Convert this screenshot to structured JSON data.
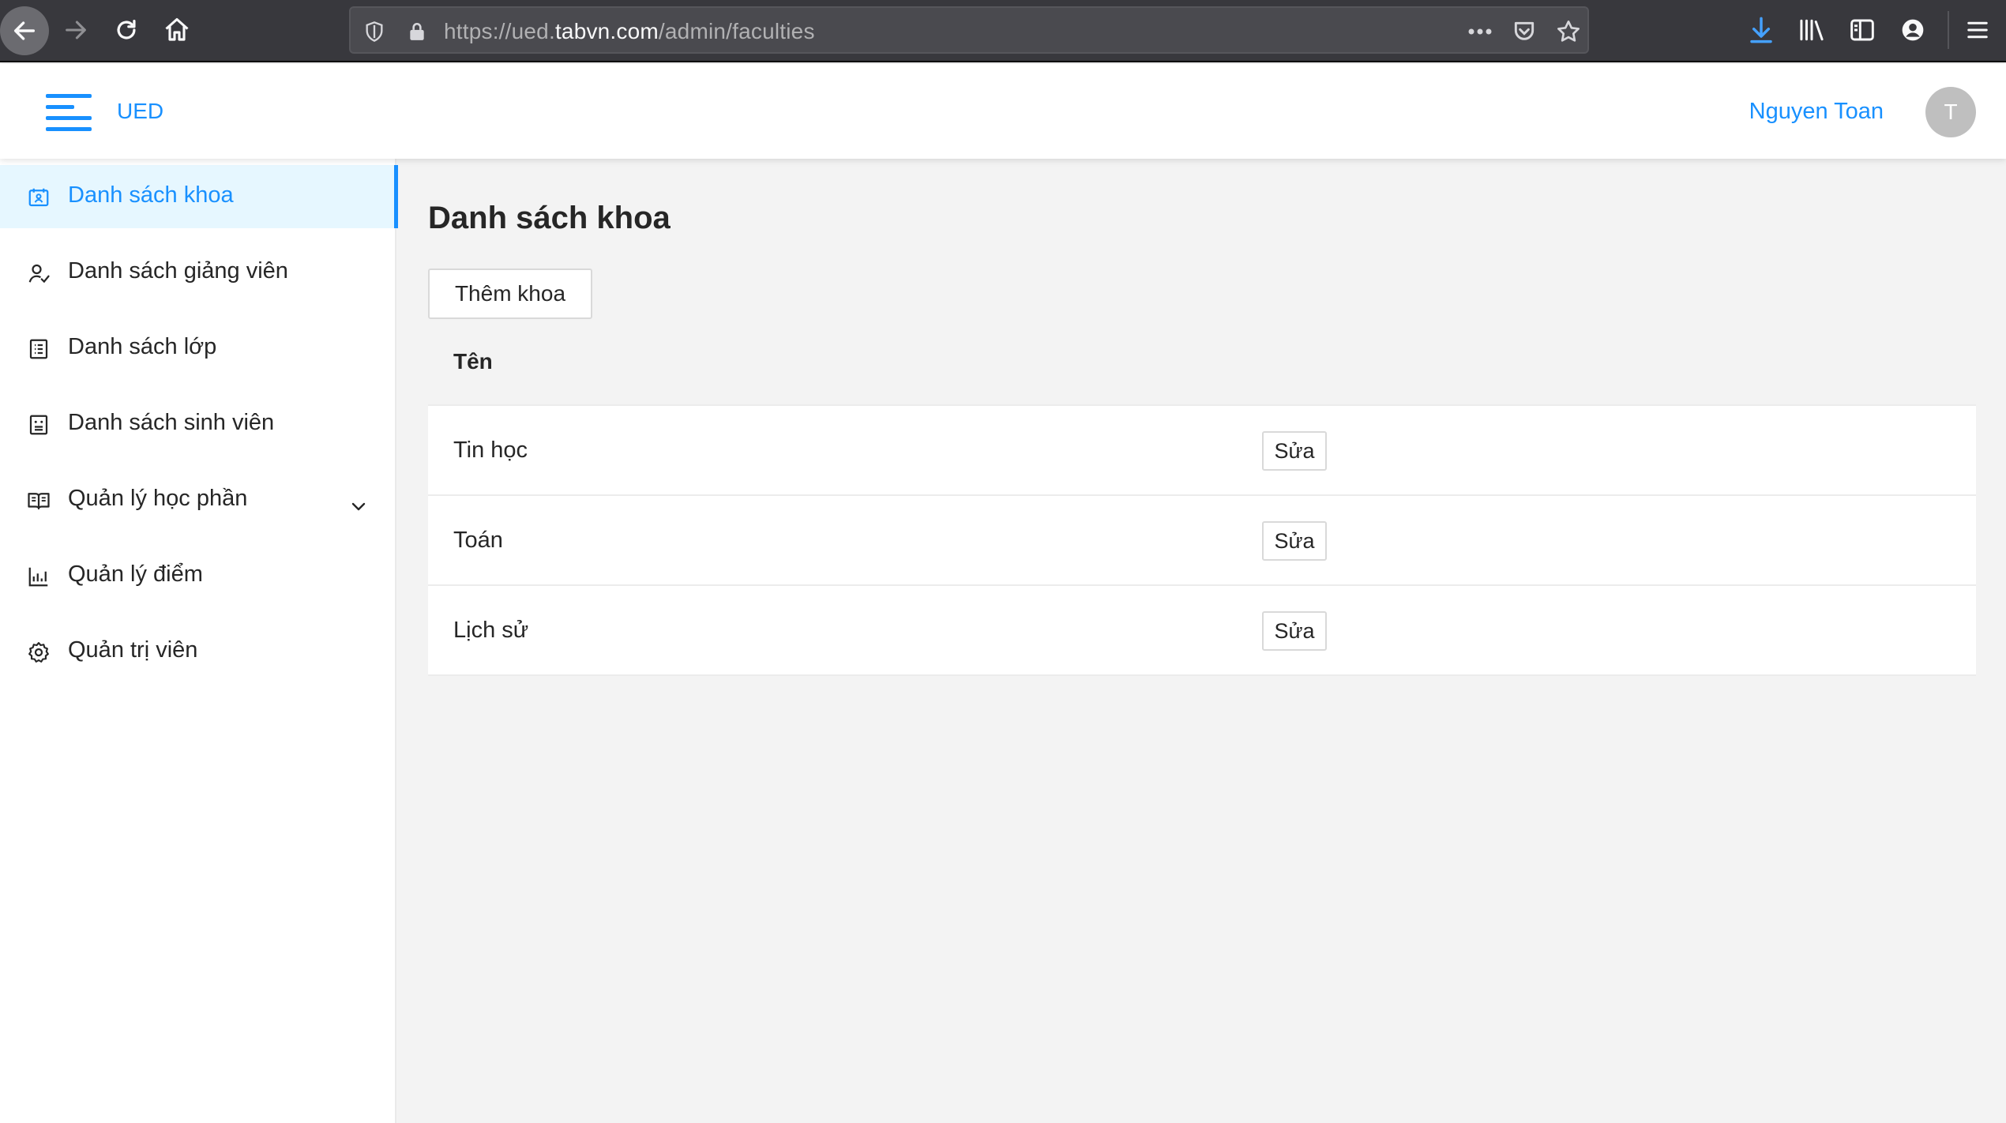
{
  "browser": {
    "url_prefix": "https://ued.",
    "url_domain": "tabvn.com",
    "url_path": "/admin/faculties",
    "accent": "#38383d"
  },
  "header": {
    "brand": "UED",
    "user_name": "Nguyen Toan",
    "avatar_initial": "T",
    "accent": "#1890ff"
  },
  "sidebar": {
    "items": [
      {
        "label": "Danh sách khoa",
        "icon": "faculty-card-icon",
        "active": true
      },
      {
        "label": "Danh sách giảng viên",
        "icon": "teacher-icon",
        "active": false
      },
      {
        "label": "Danh sách lớp",
        "icon": "class-list-icon",
        "active": false
      },
      {
        "label": "Danh sách sinh viên",
        "icon": "student-icon",
        "active": false
      },
      {
        "label": "Quản lý học phần",
        "icon": "book-icon",
        "active": false,
        "expandable": true
      },
      {
        "label": "Quản lý điểm",
        "icon": "bar-chart-icon",
        "active": false
      },
      {
        "label": "Quản trị viên",
        "icon": "gear-icon",
        "active": false
      }
    ]
  },
  "main": {
    "title": "Danh sách khoa",
    "add_button": "Thêm khoa",
    "table": {
      "header": "Tên",
      "edit_label": "Sửa",
      "rows": [
        "Tin học",
        "Toán",
        "Lịch sử"
      ]
    }
  }
}
